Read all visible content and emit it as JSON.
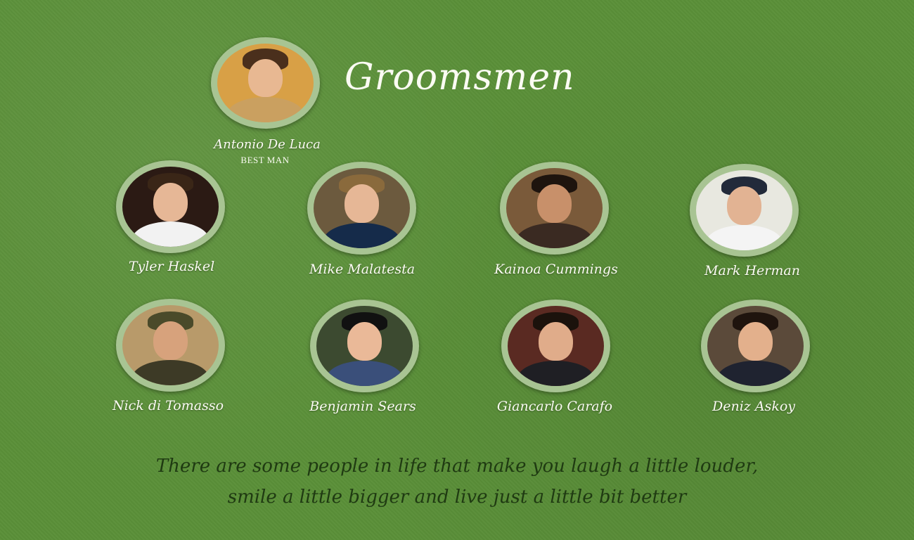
{
  "page": {
    "title": "Groomsmen",
    "background_color": "#5a8f38",
    "text_color": "#fbfbf3",
    "quote_color": "#1f3a12"
  },
  "best_man": {
    "name": "Antonio De Luca",
    "role": "BEST MAN"
  },
  "groomsmen": [
    {
      "name": "Tyler Haskel"
    },
    {
      "name": "Mike Malatesta"
    },
    {
      "name": "Kainoa Cummings"
    },
    {
      "name": "Mark Herman"
    },
    {
      "name": "Nick di Tomasso"
    },
    {
      "name": "Benjamin Sears"
    },
    {
      "name": "Giancarlo Carafo"
    },
    {
      "name": "Deniz Askoy"
    }
  ],
  "quote": {
    "line1": "There are some people in life that make you laugh a little louder,",
    "line2": "smile a little bigger and live just a little bit better"
  }
}
